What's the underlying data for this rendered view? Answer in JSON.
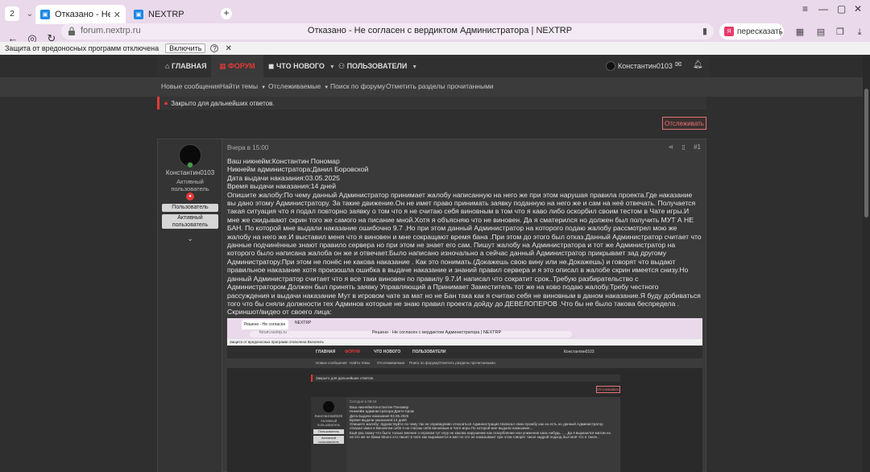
{
  "browser": {
    "tab_count": "2",
    "tabs": [
      {
        "label": "Отказано - Не согласен"
      },
      {
        "label": "NEXTRP"
      }
    ],
    "url": "forum.nextrp.ru",
    "page_title": "Отказано - Не согласен с вердиктом Администратора | NEXTRP",
    "translate_label": "пересказать",
    "protection": {
      "text": "Защита от вредоносных программ отключена",
      "enable_label": "Включить",
      "help": "?"
    }
  },
  "nav": {
    "items": [
      {
        "label": "ГЛАВНАЯ"
      },
      {
        "label": "ФОРУМ"
      },
      {
        "label": "ЧТО НОВОГО"
      },
      {
        "label": "ПОЛЬЗОВАТЕЛИ"
      }
    ],
    "username": "Константин0103"
  },
  "subnav": {
    "items": [
      {
        "label": "Новые сообщения"
      },
      {
        "label": "Найти темы"
      },
      {
        "label": "Отслеживаемые"
      },
      {
        "label": "Поиск по форуму"
      },
      {
        "label": "Отметить разделы прочитанными"
      }
    ]
  },
  "thread": {
    "locked_notice": "Закрыто для дальнейших ответов.",
    "watch_label": "Отслеживать"
  },
  "post": {
    "time": "Вчера в 15:00",
    "number": "#1",
    "author": "Константин0103",
    "author_title": "Активный пользователь",
    "badge_user": "Пользователь",
    "badge_active": "Активный пользователь",
    "lines": [
      "Ваш никнейм:Константин Пономар",
      "Никнейм администратора:Данил Боровской",
      "Дата выдачи наказания:03.05.2025",
      "Время выдачи наказания:14 дней",
      "Опишите жалобу:По чему данный Администратор принимает жалобу написанную на него же при этом нарушая правила проекта.Где наказание вы дано этому Администратору. За такие движение.Он не имет право принимать заявку поданную на него же и сам на неё отвечать. Получается такая ситуация что я подал повторно заявку о том что я не считаю себя виновным в том что я каво либо оскорбил своим тестом в Чате игры.И мне же скидывают скрин того же самого на писание мной.Хотя я объясняю что не виновен. Да я сматерился но должен был получить МУТ А НЕ БАН. По которой мне выдали наказание ошибочно 9.7 .Но при этом данный Администратор на которого подаю жалобу рассмотрел мою же жалобу на него же.И выставил меня что я виновен и мне сокращают время бана .При этом до этого был отказ.Данный Администратор считает что данные подчинённые знают правило сервера но при этом не знает его сам. Пишут жалобу на Администратора и тот же Администратор на которого было написана жалоба он же и отвечает.Было написано изночально а сейчас данный Администратор прикрывает зад другому Администратору.При этом не понёс не какова наказание . Как это понимать.(Докажешь свою вину или не.Докажешь) и говорят что выдают правильное наказание хотя произошла ошибка в выдаче наказание и знаний правил сервера и я это описал в жалобе скрин имеется снизу.Но данный Администратор считает что я все таки виновен по правилу 9.7.И написал что сократит срок..Требую разбирательство с Администратором.Должен был принять заявку Управляющий а Принимает Заместитель тот же на ково подаю жалобу.Требу честного рассуждения и выдачи наказание Мут в игровом чате за мат но не Бан така как я считаю себя не виновным в даном наказание.Я буду добиваться того что бы сняли должности тех Админов которые не знаю правил проекта дойду до ДЕВЕЛОПЕРОВ .Что бы не было такова беспредела .",
      "Скриншот/видео от своего лица:"
    ]
  },
  "screenshot": {
    "tab_label": "Решено - Не согласен",
    "tab2_label": "NEXTRP",
    "url": "forum.nextrp.ru",
    "title": "Решено · Не согласен с вердиктом Администратора | NEXTRP",
    "protection": "Защита от вредоносных программ отключена  Включить",
    "nav": [
      "ГЛАВНАЯ",
      "ФОРУМ",
      "ЧТО НОВОГО",
      "ПОЛЬЗОВАТЕЛИ"
    ],
    "nav_user": "Константин0103",
    "subnav": [
      "Новые сообщения",
      "Найти темы",
      "Отслеживаемые",
      "Поиск по форуму",
      "Отметить разделы прочитанными"
    ],
    "locked": "Закрыто для дальнейших ответов.",
    "watch": "Отслеживать",
    "time": "Сегодня в 09:34",
    "author": "Константин0103",
    "author_title": "Активный пользователь",
    "badge_user": "Пользователь",
    "badge_active": "Активный пользователь",
    "text": "Ваш никнейм:Константин Пономар\nНикнейм администратора:Данте Кром\nДата выдачи наказания:03.05.2025\nВремя выдачи наказания:14 дней\nОпишите жалобу: Здравствуйте по чему так не справедливо относиться Администрация Написал свою прожбу как он есть но данный Администратор отказал имел в Виновтем себя я не считаю себя виновным в Чате игры.По которой мне выдали наказание...\nЕщё раз скажу что было только мнение о игровом тут игру не какова нарушение как оскорбление или унижение каих нибудь ..... Да я выразился матом но не его же не Вами Много кто пишет в чате как выражается и мат но это не наказывают при этом говорят такое кадрой подход был моё что я такое..."
  }
}
